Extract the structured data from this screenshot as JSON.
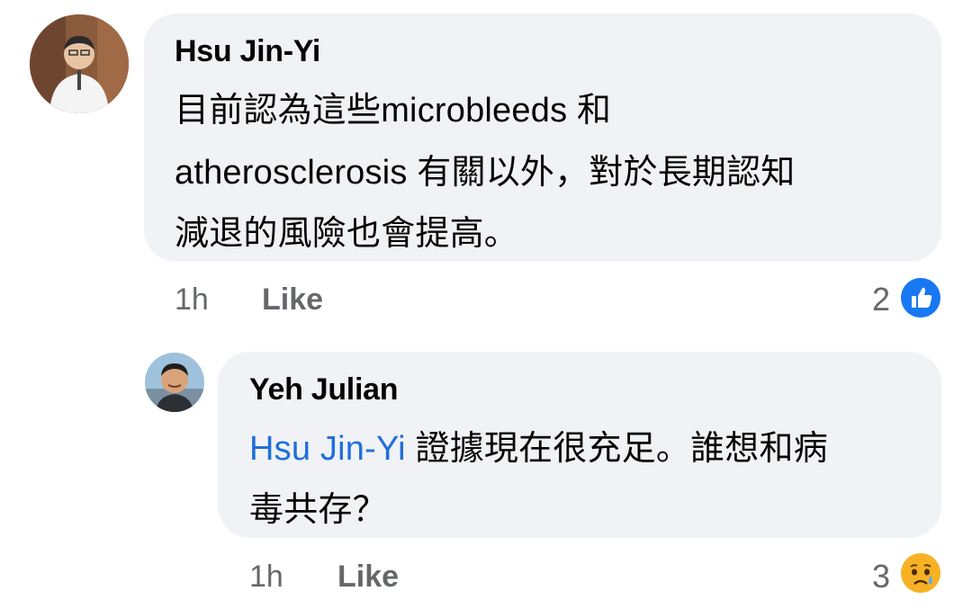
{
  "comments": [
    {
      "author": "Hsu Jin-Yi",
      "lines": [
        "目前認為這些microbleeds 和",
        "atherosclerosis 有關以外，對於長期認知",
        "減退的風險也會提高。"
      ],
      "time": "1h",
      "like_label": "Like",
      "reaction_count": "2",
      "reaction_icon": "like-icon",
      "reaction_color": "#1877f2"
    },
    {
      "author": "Yeh Julian",
      "mention": "Hsu Jin-Yi",
      "lines": [
        " 證據現在很充足。誰想和病",
        "毒共存？"
      ],
      "time": "1h",
      "like_label": "Like",
      "reaction_count": "3",
      "reaction_icon": "sad-icon",
      "reaction_color": "#f7b125"
    }
  ]
}
